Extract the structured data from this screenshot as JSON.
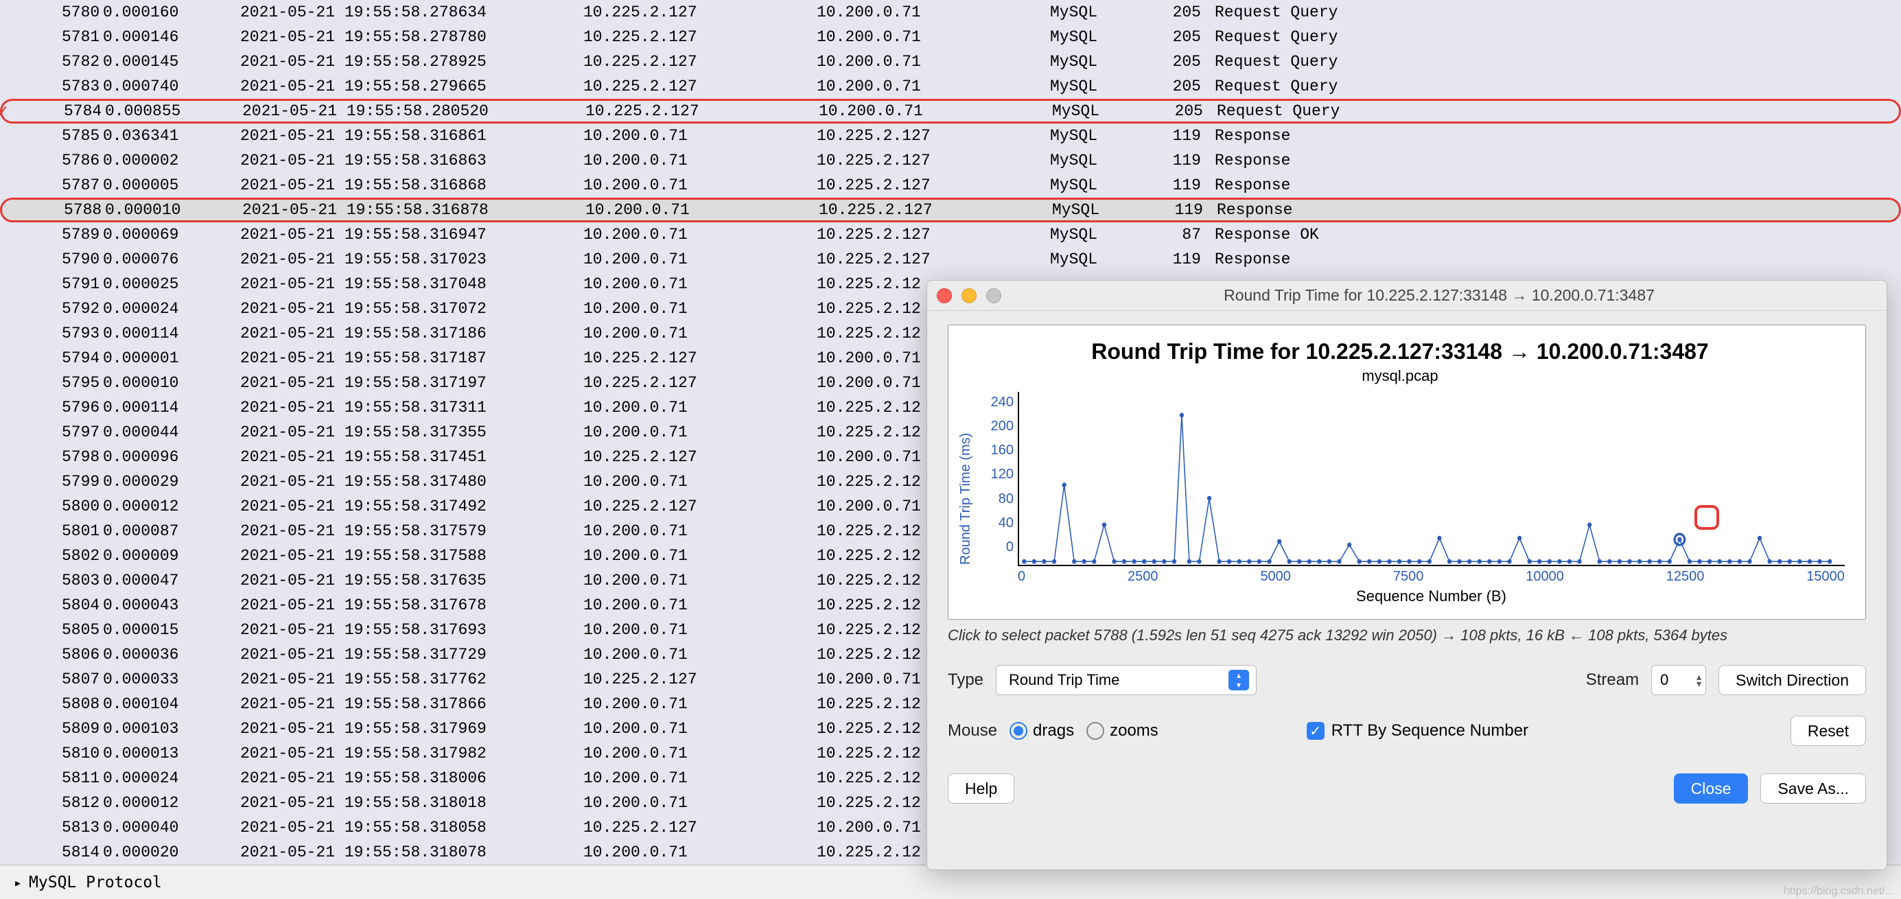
{
  "packets": [
    {
      "no": "5780",
      "time": "0.000160",
      "date": "2021-05-21 19:55:58.278634",
      "src": "10.225.2.127",
      "dst": "10.200.0.71",
      "proto": "MySQL",
      "len": "205",
      "info": "Request Query"
    },
    {
      "no": "5781",
      "time": "0.000146",
      "date": "2021-05-21 19:55:58.278780",
      "src": "10.225.2.127",
      "dst": "10.200.0.71",
      "proto": "MySQL",
      "len": "205",
      "info": "Request Query"
    },
    {
      "no": "5782",
      "time": "0.000145",
      "date": "2021-05-21 19:55:58.278925",
      "src": "10.225.2.127",
      "dst": "10.200.0.71",
      "proto": "MySQL",
      "len": "205",
      "info": "Request Query"
    },
    {
      "no": "5783",
      "time": "0.000740",
      "date": "2021-05-21 19:55:58.279665",
      "src": "10.225.2.127",
      "dst": "10.200.0.71",
      "proto": "MySQL",
      "len": "205",
      "info": "Request Query"
    },
    {
      "no": "5784",
      "time": "0.000855",
      "date": "2021-05-21 19:55:58.280520",
      "src": "10.225.2.127",
      "dst": "10.200.0.71",
      "proto": "MySQL",
      "len": "205",
      "info": "Request Query",
      "hl": 1,
      "check": true
    },
    {
      "no": "5785",
      "time": "0.036341",
      "date": "2021-05-21 19:55:58.316861",
      "src": "10.200.0.71",
      "dst": "10.225.2.127",
      "proto": "MySQL",
      "len": "119",
      "info": "Response"
    },
    {
      "no": "5786",
      "time": "0.000002",
      "date": "2021-05-21 19:55:58.316863",
      "src": "10.200.0.71",
      "dst": "10.225.2.127",
      "proto": "MySQL",
      "len": "119",
      "info": "Response"
    },
    {
      "no": "5787",
      "time": "0.000005",
      "date": "2021-05-21 19:55:58.316868",
      "src": "10.200.0.71",
      "dst": "10.225.2.127",
      "proto": "MySQL",
      "len": "119",
      "info": "Response"
    },
    {
      "no": "5788",
      "time": "0.000010",
      "date": "2021-05-21 19:55:58.316878",
      "src": "10.200.0.71",
      "dst": "10.225.2.127",
      "proto": "MySQL",
      "len": "119",
      "info": "Response",
      "hl": 2
    },
    {
      "no": "5789",
      "time": "0.000069",
      "date": "2021-05-21 19:55:58.316947",
      "src": "10.200.0.71",
      "dst": "10.225.2.127",
      "proto": "MySQL",
      "len": "87",
      "info": "Response OK"
    },
    {
      "no": "5790",
      "time": "0.000076",
      "date": "2021-05-21 19:55:58.317023",
      "src": "10.200.0.71",
      "dst": "10.225.2.127",
      "proto": "MySQL",
      "len": "119",
      "info": "Response"
    },
    {
      "no": "5791",
      "time": "0.000025",
      "date": "2021-05-21 19:55:58.317048",
      "src": "10.200.0.71",
      "dst": "10.225.2.12",
      "proto": "",
      "len": "",
      "info": ""
    },
    {
      "no": "5792",
      "time": "0.000024",
      "date": "2021-05-21 19:55:58.317072",
      "src": "10.200.0.71",
      "dst": "10.225.2.12",
      "proto": "",
      "len": "",
      "info": ""
    },
    {
      "no": "5793",
      "time": "0.000114",
      "date": "2021-05-21 19:55:58.317186",
      "src": "10.200.0.71",
      "dst": "10.225.2.12",
      "proto": "",
      "len": "",
      "info": ""
    },
    {
      "no": "5794",
      "time": "0.000001",
      "date": "2021-05-21 19:55:58.317187",
      "src": "10.225.2.127",
      "dst": "10.200.0.71",
      "proto": "",
      "len": "",
      "info": ""
    },
    {
      "no": "5795",
      "time": "0.000010",
      "date": "2021-05-21 19:55:58.317197",
      "src": "10.225.2.127",
      "dst": "10.200.0.71",
      "proto": "",
      "len": "",
      "info": ""
    },
    {
      "no": "5796",
      "time": "0.000114",
      "date": "2021-05-21 19:55:58.317311",
      "src": "10.200.0.71",
      "dst": "10.225.2.12",
      "proto": "",
      "len": "",
      "info": ""
    },
    {
      "no": "5797",
      "time": "0.000044",
      "date": "2021-05-21 19:55:58.317355",
      "src": "10.200.0.71",
      "dst": "10.225.2.12",
      "proto": "",
      "len": "",
      "info": ""
    },
    {
      "no": "5798",
      "time": "0.000096",
      "date": "2021-05-21 19:55:58.317451",
      "src": "10.225.2.127",
      "dst": "10.200.0.71",
      "proto": "",
      "len": "",
      "info": ""
    },
    {
      "no": "5799",
      "time": "0.000029",
      "date": "2021-05-21 19:55:58.317480",
      "src": "10.200.0.71",
      "dst": "10.225.2.12",
      "proto": "",
      "len": "",
      "info": ""
    },
    {
      "no": "5800",
      "time": "0.000012",
      "date": "2021-05-21 19:55:58.317492",
      "src": "10.225.2.127",
      "dst": "10.200.0.71",
      "proto": "",
      "len": "",
      "info": ""
    },
    {
      "no": "5801",
      "time": "0.000087",
      "date": "2021-05-21 19:55:58.317579",
      "src": "10.200.0.71",
      "dst": "10.225.2.12",
      "proto": "",
      "len": "",
      "info": ""
    },
    {
      "no": "5802",
      "time": "0.000009",
      "date": "2021-05-21 19:55:58.317588",
      "src": "10.200.0.71",
      "dst": "10.225.2.12",
      "proto": "",
      "len": "",
      "info": ""
    },
    {
      "no": "5803",
      "time": "0.000047",
      "date": "2021-05-21 19:55:58.317635",
      "src": "10.200.0.71",
      "dst": "10.225.2.12",
      "proto": "",
      "len": "",
      "info": ""
    },
    {
      "no": "5804",
      "time": "0.000043",
      "date": "2021-05-21 19:55:58.317678",
      "src": "10.200.0.71",
      "dst": "10.225.2.12",
      "proto": "",
      "len": "",
      "info": ""
    },
    {
      "no": "5805",
      "time": "0.000015",
      "date": "2021-05-21 19:55:58.317693",
      "src": "10.200.0.71",
      "dst": "10.225.2.12",
      "proto": "",
      "len": "",
      "info": ""
    },
    {
      "no": "5806",
      "time": "0.000036",
      "date": "2021-05-21 19:55:58.317729",
      "src": "10.200.0.71",
      "dst": "10.225.2.12",
      "proto": "",
      "len": "",
      "info": ""
    },
    {
      "no": "5807",
      "time": "0.000033",
      "date": "2021-05-21 19:55:58.317762",
      "src": "10.225.2.127",
      "dst": "10.200.0.71",
      "proto": "",
      "len": "",
      "info": ""
    },
    {
      "no": "5808",
      "time": "0.000104",
      "date": "2021-05-21 19:55:58.317866",
      "src": "10.200.0.71",
      "dst": "10.225.2.12",
      "proto": "",
      "len": "",
      "info": ""
    },
    {
      "no": "5809",
      "time": "0.000103",
      "date": "2021-05-21 19:55:58.317969",
      "src": "10.200.0.71",
      "dst": "10.225.2.12",
      "proto": "",
      "len": "",
      "info": ""
    },
    {
      "no": "5810",
      "time": "0.000013",
      "date": "2021-05-21 19:55:58.317982",
      "src": "10.200.0.71",
      "dst": "10.225.2.12",
      "proto": "",
      "len": "",
      "info": ""
    },
    {
      "no": "5811",
      "time": "0.000024",
      "date": "2021-05-21 19:55:58.318006",
      "src": "10.200.0.71",
      "dst": "10.225.2.12",
      "proto": "",
      "len": "",
      "info": ""
    },
    {
      "no": "5812",
      "time": "0.000012",
      "date": "2021-05-21 19:55:58.318018",
      "src": "10.200.0.71",
      "dst": "10.225.2.12",
      "proto": "",
      "len": "",
      "info": ""
    },
    {
      "no": "5813",
      "time": "0.000040",
      "date": "2021-05-21 19:55:58.318058",
      "src": "10.225.2.127",
      "dst": "10.200.0.71",
      "proto": "",
      "len": "",
      "info": ""
    },
    {
      "no": "5814",
      "time": "0.000020",
      "date": "2021-05-21 19:55:58.318078",
      "src": "10.200.0.71",
      "dst": "10.225.2.12",
      "proto": "",
      "len": "",
      "info": ""
    }
  ],
  "footer": {
    "protocol_header": "MySQL Protocol"
  },
  "dialog": {
    "window_title": "Round Trip Time for 10.225.2.127:33148 → 10.200.0.71:3487",
    "chart_title": "Round Trip Time for 10.225.2.127:33148 → 10.200.0.71:3487",
    "chart_subtitle": "mysql.pcap",
    "ylabel": "Round Trip Time (ms)",
    "xlabel": "Sequence Number (B)",
    "hint": "Click to select packet 5788 (1.592s len 51 seq 4275 ack 13292 win 2050) → 108 pkts, 16 kB ← 108 pkts, 5364 bytes",
    "type_label": "Type",
    "type_value": "Round Trip Time",
    "stream_label": "Stream",
    "stream_value": "0",
    "switch_btn": "Switch Direction",
    "mouse_label": "Mouse",
    "drags": "drags",
    "zooms": "zooms",
    "rtt_checkbox": "RTT By Sequence Number",
    "reset_btn": "Reset",
    "help_btn": "Help",
    "close_btn": "Close",
    "saveas_btn": "Save As...",
    "yticks": [
      "240",
      "200",
      "160",
      "120",
      "80",
      "40",
      "0"
    ],
    "xticks": [
      "0",
      "2500",
      "5000",
      "7500",
      "10000",
      "12500",
      "15000"
    ]
  },
  "chart_data": {
    "type": "line",
    "title": "Round Trip Time for 10.225.2.127:33148 → 10.200.0.71:3487",
    "subtitle": "mysql.pcap",
    "xlabel": "Sequence Number (B)",
    "ylabel": "Round Trip Time (ms)",
    "xlim": [
      0,
      16500
    ],
    "ylim": [
      0,
      260
    ],
    "series": [
      {
        "name": "RTT",
        "x": [
          100,
          300,
          500,
          700,
          900,
          1100,
          1300,
          1500,
          1700,
          1900,
          2100,
          2300,
          2500,
          2700,
          2900,
          3100,
          3250,
          3400,
          3600,
          3800,
          4000,
          4200,
          4400,
          4600,
          4800,
          5000,
          5200,
          5400,
          5600,
          5800,
          6000,
          6200,
          6400,
          6600,
          6800,
          7000,
          7200,
          7400,
          7600,
          7800,
          8000,
          8200,
          8400,
          8600,
          8800,
          9000,
          9200,
          9400,
          9600,
          9800,
          10000,
          10200,
          10400,
          10600,
          10800,
          11000,
          11200,
          11400,
          11600,
          11800,
          12000,
          12200,
          12400,
          12600,
          12800,
          13000,
          13200,
          13400,
          13600,
          13800,
          14000,
          14200,
          14400,
          14600,
          14800,
          15000,
          15200,
          15400,
          15600,
          15800,
          16000,
          16200
        ],
        "y": [
          5,
          5,
          5,
          5,
          120,
          5,
          5,
          5,
          60,
          5,
          5,
          5,
          5,
          5,
          5,
          5,
          225,
          5,
          5,
          100,
          5,
          5,
          5,
          5,
          5,
          5,
          35,
          5,
          5,
          5,
          5,
          5,
          5,
          30,
          5,
          5,
          5,
          5,
          5,
          5,
          5,
          5,
          40,
          5,
          5,
          5,
          5,
          5,
          5,
          5,
          40,
          5,
          5,
          5,
          5,
          5,
          5,
          60,
          5,
          5,
          5,
          5,
          5,
          5,
          5,
          5,
          38,
          5,
          5,
          5,
          5,
          5,
          5,
          5,
          40,
          5,
          5,
          5,
          5,
          5,
          5,
          5
        ]
      }
    ],
    "highlight_point": {
      "x": 13200,
      "y": 38
    }
  },
  "watermark": "https://blog.csdn.net/..."
}
